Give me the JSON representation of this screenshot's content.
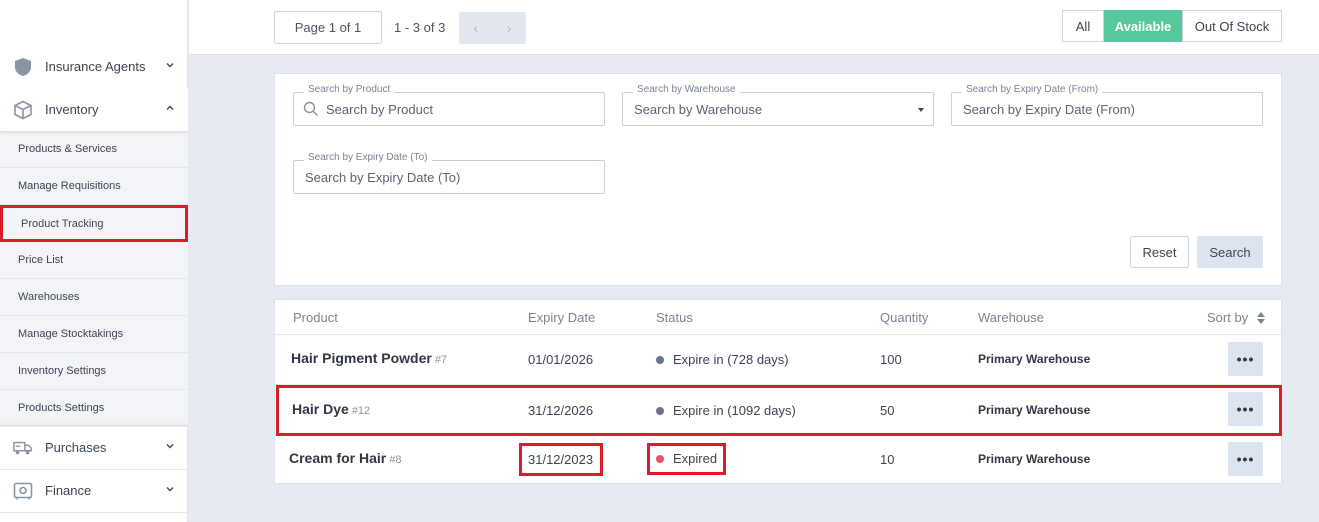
{
  "sidebar": {
    "groups": [
      {
        "label": "Insurance Agents",
        "icon": "shield-icon",
        "state": "collapsed"
      },
      {
        "label": "Inventory",
        "icon": "box-icon",
        "state": "expanded"
      },
      {
        "label": "Purchases",
        "icon": "truck-icon",
        "state": "collapsed"
      },
      {
        "label": "Finance",
        "icon": "safe-icon",
        "state": "collapsed"
      }
    ],
    "inventory_items": [
      {
        "label": "Products & Services"
      },
      {
        "label": "Manage Requisitions"
      },
      {
        "label": "Product Tracking",
        "highlighted": true
      },
      {
        "label": "Price List"
      },
      {
        "label": "Warehouses"
      },
      {
        "label": "Manage Stocktakings"
      },
      {
        "label": "Inventory Settings"
      },
      {
        "label": "Products Settings"
      }
    ]
  },
  "topbar": {
    "page_label": "Page 1 of 1",
    "range_label": "1 - 3 of 3",
    "prev": "‹",
    "next": "›",
    "filters": [
      {
        "label": "All",
        "active": false
      },
      {
        "label": "Available",
        "active": true
      },
      {
        "label": "Out Of Stock",
        "active": false
      }
    ]
  },
  "search": {
    "product": {
      "label": "Search by Product",
      "placeholder": "Search by Product"
    },
    "warehouse": {
      "label": "Search by Warehouse",
      "placeholder": "Search by Warehouse"
    },
    "expiry_from": {
      "label": "Search by Expiry Date (From)",
      "placeholder": "Search by Expiry Date (From)"
    },
    "expiry_to": {
      "label": "Search by Expiry Date (To)",
      "placeholder": "Search by Expiry Date (To)"
    },
    "reset_label": "Reset",
    "search_label": "Search"
  },
  "table": {
    "headers": {
      "product": "Product",
      "expiry": "Expiry Date",
      "status": "Status",
      "quantity": "Quantity",
      "warehouse": "Warehouse",
      "sort": "Sort by"
    },
    "rows": [
      {
        "name": "Hair Pigment Powder",
        "id": "#7",
        "expiry": "01/01/2026",
        "status": "Expire in (728 days)",
        "status_color": "#6b7390",
        "quantity": "100",
        "warehouse": "Primary Warehouse",
        "more": "•••"
      },
      {
        "name": "Hair Dye",
        "id": "#12",
        "expiry": "31/12/2026",
        "status": "Expire in (1092 days)",
        "status_color": "#6b7390",
        "quantity": "50",
        "warehouse": "Primary Warehouse",
        "more": "•••"
      },
      {
        "name": "Cream for Hair",
        "id": "#8",
        "expiry": "31/12/2023",
        "status": "Expired",
        "status_color": "#ee4e6c",
        "quantity": "10",
        "warehouse": "Primary Warehouse",
        "more": "•••"
      }
    ]
  },
  "colors": {
    "accent_green": "#56c89b",
    "highlight_red": "#dc1c2a",
    "expired_red": "#ee4e6c",
    "expiring_gray": "#6b7390"
  }
}
